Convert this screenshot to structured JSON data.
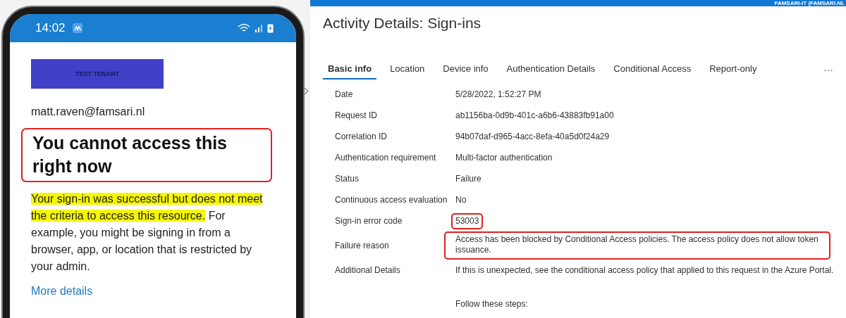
{
  "phone": {
    "status_bar": {
      "time": "14:02"
    },
    "tenant_banner": "TEST TENANT",
    "email": "matt.raven@famsari.nl",
    "heading": {
      "text": "You cannot access this right now",
      "annotated": true
    },
    "message": [
      {
        "text": "Your sign-in was successful but does not meet the criteria to access this resource.",
        "highlighted": true
      },
      {
        "text": " For example, you might be signing in from a browser, app, or location that is restricted by your admin.",
        "highlighted": false
      }
    ],
    "link": "More details"
  },
  "portal": {
    "account": "FAMSARI-IT (FAMSARI.NL",
    "title": "Activity Details: Sign-ins",
    "tabs": [
      {
        "label": "Basic info",
        "selected": true
      },
      {
        "label": "Location",
        "selected": false
      },
      {
        "label": "Device info",
        "selected": false
      },
      {
        "label": "Authentication Details",
        "selected": false
      },
      {
        "label": "Conditional Access",
        "selected": false
      },
      {
        "label": "Report-only",
        "selected": false
      }
    ],
    "more": "···",
    "rows": [
      {
        "label": "Date",
        "value": "5/28/2022, 1:52:27 PM",
        "annotated": false
      },
      {
        "label": "Request ID",
        "value": "ab1156ba-0d9b-401c-a6b6-43883fb91a00",
        "annotated": false
      },
      {
        "label": "Correlation ID",
        "value": "94b07daf-d965-4acc-8efa-40a5d0f24a29",
        "annotated": false
      },
      {
        "label": "Authentication requirement",
        "value": "Multi-factor authentication",
        "annotated": false
      },
      {
        "label": "Status",
        "value": "Failure",
        "annotated": false
      },
      {
        "label": "Continuous access evaluation",
        "value": "No",
        "annotated": false
      },
      {
        "label": "Sign-in error code",
        "value": "53003",
        "annotated": true
      },
      {
        "label": "Failure reason",
        "value": "Access has been blocked by Conditional Access policies. The access policy does not allow token issuance.",
        "annotated": true
      },
      {
        "label": "Additional Details",
        "value": "If this is unexpected, see the conditional access policy that applied to this request in the Azure Portal.",
        "annotated": false
      }
    ],
    "steps_heading": "Follow these steps:"
  }
}
